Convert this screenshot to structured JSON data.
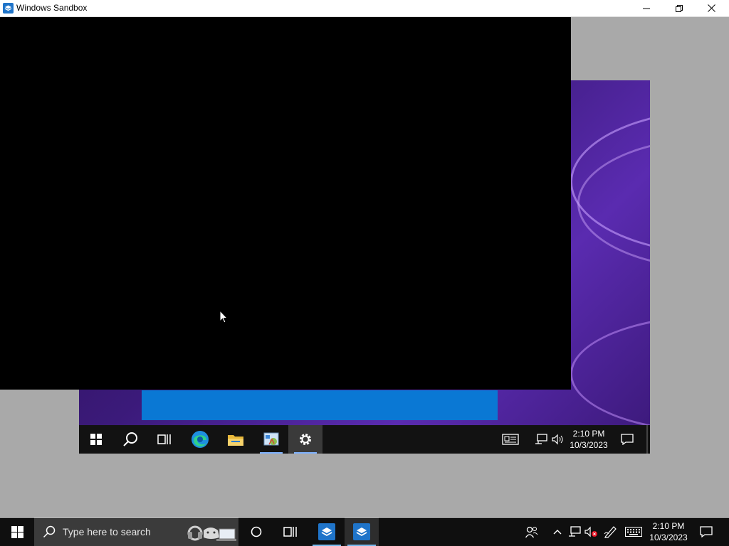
{
  "window": {
    "title": "Windows Sandbox",
    "icon": "sandbox-icon",
    "controls": [
      "minimize-icon",
      "restore-icon",
      "close-icon"
    ]
  },
  "sandbox": {
    "taskbar": {
      "items": [
        "start-icon",
        "search-icon",
        "task-view-icon",
        "edge-icon",
        "file-explorer-icon",
        "control-panel-icon",
        "settings-icon"
      ],
      "active_item": "settings-icon",
      "tray": [
        "news-icon",
        "network-icon",
        "volume-icon"
      ],
      "time": "2:10 PM",
      "date": "10/3/2023",
      "notification_icon": "action-center-icon"
    }
  },
  "taskbar": {
    "search_placeholder": "Type here to search",
    "items": [
      "start-icon",
      "search-icon",
      "cortana-icon",
      "task-view-icon",
      "sandbox-icon",
      "sandbox-icon-active"
    ],
    "tray": [
      "people-icon",
      "chevron-up-icon",
      "network-icon",
      "volume-muted-icon",
      "pen-icon",
      "keyboard-icon"
    ],
    "time": "2:10 PM",
    "date": "10/3/2023",
    "notification_icon": "action-center-icon"
  },
  "colors": {
    "accent": "#0a78d4",
    "taskbar": "#0f0f0f",
    "client_bg": "#a9a9a9"
  }
}
